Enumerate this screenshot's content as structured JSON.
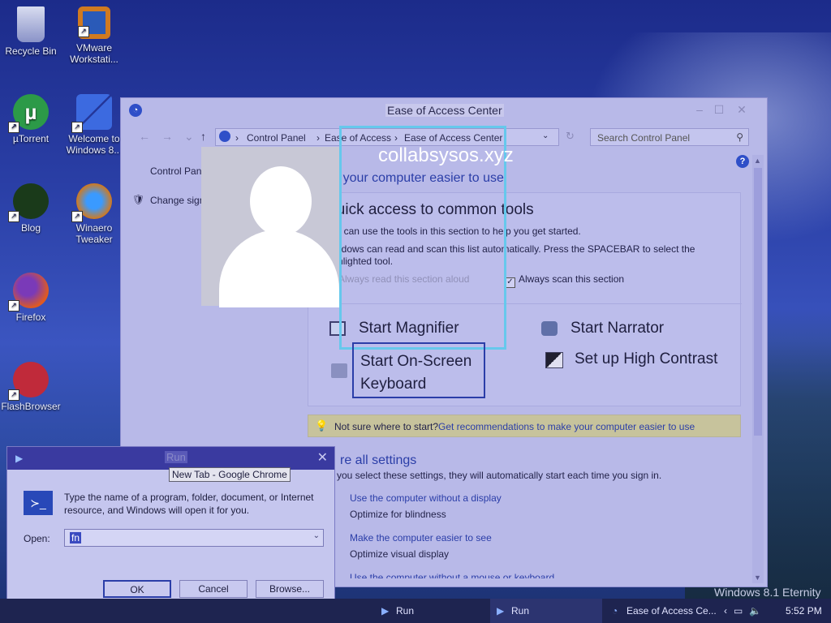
{
  "desktop": {
    "icons": [
      {
        "label": "Recycle Bin"
      },
      {
        "label": "VMware Workstati..."
      },
      {
        "label": "µTorrent"
      },
      {
        "label": "Welcome to Windows 8..."
      },
      {
        "label": "Blog"
      },
      {
        "label": "Winaero Tweaker"
      },
      {
        "label": "Firefox"
      },
      {
        "label": "FlashBrowser"
      }
    ],
    "watermark": "collabsysos.xyz",
    "windows_version": "Windows 8.1 Eternity"
  },
  "window": {
    "title": "Ease of Access Center",
    "breadcrumb": [
      "Control Panel",
      "Ease of Access",
      "Ease of Access Center"
    ],
    "search_placeholder": "Search Control Panel",
    "left_links": [
      "Control Panel Home",
      "Change sign-in settings"
    ],
    "page_heading": "Make your computer easier to use",
    "quick_access": {
      "title": "Quick access to common tools",
      "intro": "You can use the tools in this section to help you get started.",
      "scan_text": "Windows can read and scan this list automatically.  Press the SPACEBAR to select the highlighted tool.",
      "read_aloud_label": "Always read this section aloud",
      "read_aloud_checked": false,
      "scan_label": "Always scan this section",
      "scan_checked": true,
      "tools": [
        {
          "label": "Start Magnifier",
          "icon": "magnifier-icon"
        },
        {
          "label": "Start Narrator",
          "icon": "narrator-icon"
        },
        {
          "label_line1": "Start On-Screen",
          "label_line2": "Keyboard",
          "icon": "keyboard-icon"
        },
        {
          "label": "Set up High Contrast",
          "icon": "contrast-icon"
        }
      ]
    },
    "tip": {
      "text": "Not sure where to start?",
      "link": "Get recommendations to make your computer easier to use"
    },
    "explore": {
      "heading": "re all settings",
      "intro": "you select these settings, they will automatically start each time you sign in.",
      "items": [
        {
          "link": "Use the computer without a display",
          "desc": "Optimize for blindness"
        },
        {
          "link": "Make the computer easier to see",
          "desc": "Optimize visual display"
        },
        {
          "link": "Use the computer without a mouse or keyboard",
          "desc": ""
        }
      ]
    }
  },
  "run_dialog": {
    "title": "Run",
    "description": "Type the name of a program, folder, document, or Internet resource, and Windows will open it for you.",
    "open_label": "Open:",
    "open_value": "fn",
    "buttons": {
      "ok": "OK",
      "cancel": "Cancel",
      "browse": "Browse..."
    }
  },
  "tooltip": "New Tab - Google Chrome",
  "taskbar": {
    "items": [
      {
        "label": "Run"
      },
      {
        "label": "Run"
      },
      {
        "label": "Ease of Access Ce..."
      }
    ],
    "tray_arrow": "‹",
    "clock": "5:52 PM"
  }
}
